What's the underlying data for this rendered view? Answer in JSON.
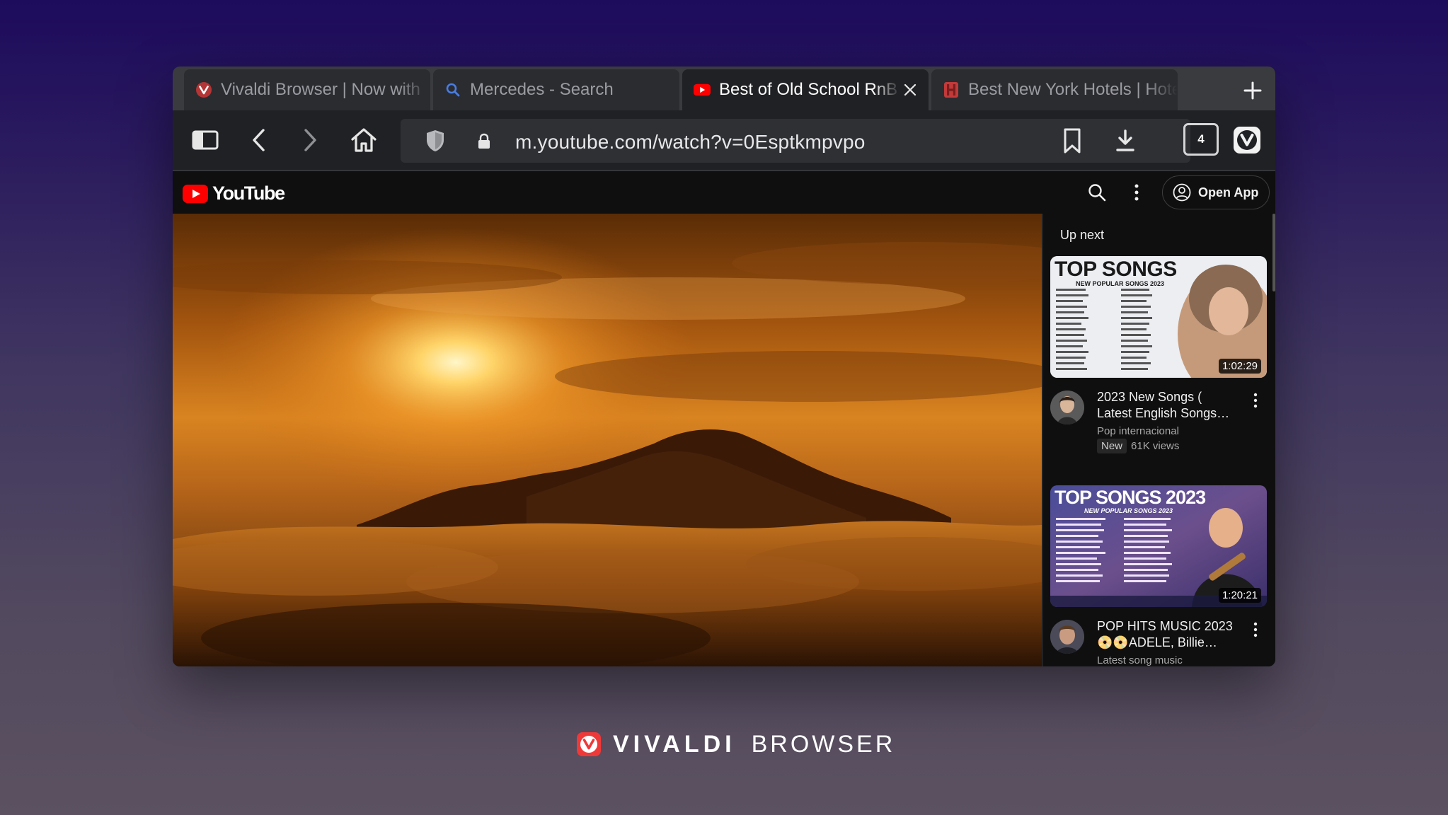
{
  "tabs": [
    {
      "title": "Vivaldi Browser | Now with",
      "favicon": "vivaldi-icon",
      "active": false
    },
    {
      "title": "Mercedes - Search",
      "favicon": "search-icon",
      "active": false
    },
    {
      "title": "Best of Old School RnB | Throwback",
      "favicon": "youtube-icon",
      "active": true
    },
    {
      "title": "Best New York Hotels | Hotels",
      "favicon": "hotels-icon",
      "active": false
    }
  ],
  "toolbar": {
    "url": "m.youtube.com/watch?v=0Esptkmpvpo",
    "tab_count": "4"
  },
  "youtube": {
    "logo_text": "YouTube",
    "open_app_label": "Open App",
    "up_next_label": "Up next",
    "videos": [
      {
        "thumb_title": "TOP SONGS",
        "thumb_subtitle": "NEW POPULAR SONGS 2023",
        "duration": "1:02:29",
        "title": "2023 New Songs ( Latest English Songs…",
        "channel": "Pop internacional",
        "badge": "New",
        "views": "61K views"
      },
      {
        "thumb_title": "TOP SONGS 2023",
        "thumb_subtitle": "NEW POPULAR SONGS 2023",
        "duration": "1:20:21",
        "title": "POP HITS MUSIC 2023 📀📀ADELE, Billie…",
        "channel": "Latest song music"
      }
    ]
  },
  "brand": {
    "word1": "VIVALDI",
    "word2": "BROWSER"
  },
  "colors": {
    "accent_red": "#ef3939",
    "youtube_red": "#ff0000",
    "tab_active": "#202124",
    "tab_inactive": "#2b2c30"
  }
}
